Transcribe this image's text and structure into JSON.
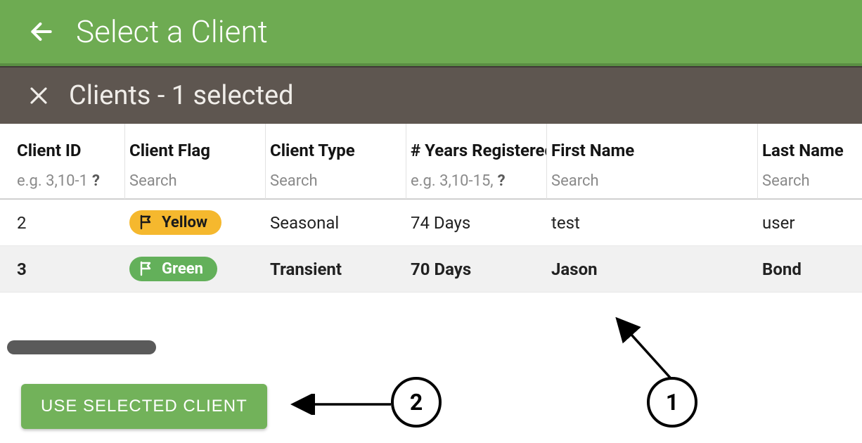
{
  "header": {
    "title": "Select a Client"
  },
  "subheader": {
    "title": "Clients  - 1 selected"
  },
  "columns": {
    "id": "Client ID",
    "flag": "Client Flag",
    "type": "Client Type",
    "years": "# Years Registered",
    "first": "First Name",
    "last": "Last Name"
  },
  "filters": {
    "id": "e.g. 3,10-1",
    "id_help": "?",
    "flag": "Search",
    "type": "Search",
    "years": "e.g. 3,10-15,",
    "years_help": "?",
    "first": "Search",
    "last": "Search"
  },
  "rows": [
    {
      "id": "2",
      "flag_label": "Yellow",
      "flag_color": "yellow",
      "type": "Seasonal",
      "years": "74 Days",
      "first": "test",
      "last": "user",
      "selected": false
    },
    {
      "id": "3",
      "flag_label": "Green",
      "flag_color": "green",
      "type": "Transient",
      "years": "70 Days",
      "first": "Jason",
      "last": "Bond",
      "selected": true
    }
  ],
  "action_button": "USE SELECTED CLIENT",
  "annotations": {
    "circle1": "1",
    "circle2": "2"
  }
}
